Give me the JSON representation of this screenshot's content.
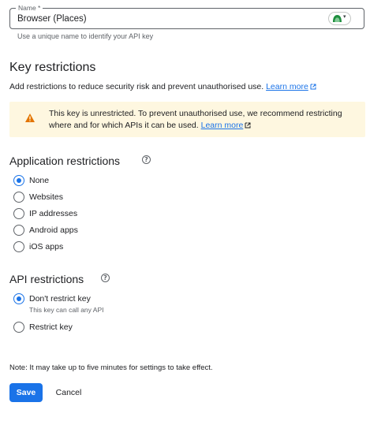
{
  "name_field": {
    "label": "Name *",
    "value": "Browser (Places)",
    "hint": "Use a unique name to identify your API key",
    "extension_icon": "green-arch-icon"
  },
  "key_restrictions": {
    "heading": "Key restrictions",
    "description": "Add restrictions to reduce security risk and prevent unauthorised use.",
    "learn_more": "Learn more"
  },
  "warning": {
    "text": "This key is unrestricted. To prevent unauthorised use, we recommend restricting where and for which APIs it can be used.",
    "learn_more": "Learn more",
    "color": "#fef7e0",
    "icon_color": "#e37400"
  },
  "application_restrictions": {
    "heading": "Application restrictions",
    "selected": "None",
    "options": [
      "None",
      "Websites",
      "IP addresses",
      "Android apps",
      "iOS apps"
    ]
  },
  "api_restrictions": {
    "heading": "API restrictions",
    "selected": "Don't restrict key",
    "options": [
      {
        "label": "Don't restrict key",
        "sub": "This key can call any API"
      },
      {
        "label": "Restrict key",
        "sub": ""
      }
    ]
  },
  "note": "Note: It may take up to five minutes for settings to take effect.",
  "buttons": {
    "save": "Save",
    "cancel": "Cancel"
  },
  "colors": {
    "accent": "#1a73e8",
    "text": "#202124",
    "muted": "#5f6368"
  }
}
